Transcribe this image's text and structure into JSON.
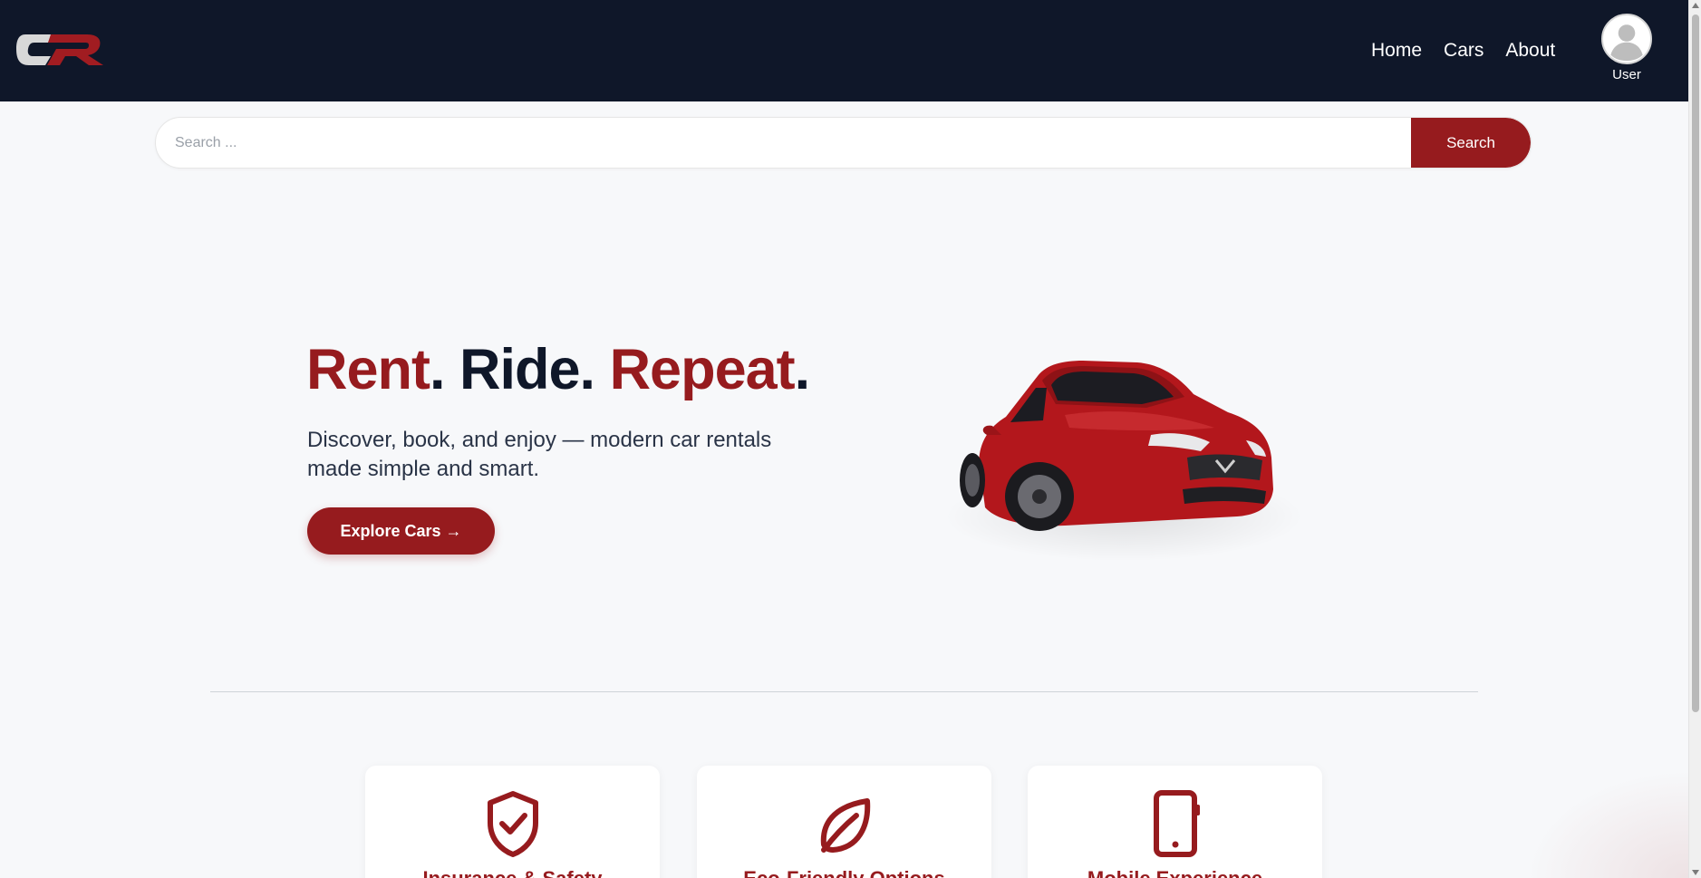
{
  "header": {
    "brand_logo_alt": "CR",
    "nav": [
      {
        "label": "Home"
      },
      {
        "label": "Cars"
      },
      {
        "label": "About"
      }
    ],
    "user_label": "User"
  },
  "search": {
    "placeholder": "Search ...",
    "value": "",
    "button_label": "Search"
  },
  "hero": {
    "title_parts": [
      "Rent",
      ". ",
      "Ride",
      ". ",
      "Repeat",
      "."
    ],
    "subtitle": "Discover, book, and enjoy — modern car rentals made simple and smart.",
    "cta_label": "Explore Cars →"
  },
  "features": [
    {
      "icon": "shield-check-icon",
      "title": "Insurance & Safety"
    },
    {
      "icon": "leaf-icon",
      "title": "Eco-Friendly Options"
    },
    {
      "icon": "mobile-phone-icon",
      "title": "Mobile Experience"
    }
  ],
  "colors": {
    "navy": "#0f1729",
    "brand_red": "#961b1e",
    "background": "#f7f8fa"
  }
}
